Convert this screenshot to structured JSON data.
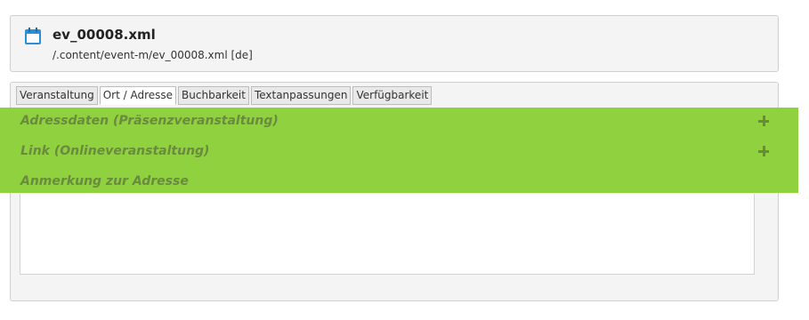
{
  "header": {
    "icon": "calendar-icon",
    "title": "ev_00008.xml",
    "path": "/.content/event-m/ev_00008.xml [de]"
  },
  "tabs": [
    {
      "label": "Veranstaltung",
      "active": false
    },
    {
      "label": "Ort / Adresse",
      "active": true
    },
    {
      "label": "Buchbarkeit",
      "active": false
    },
    {
      "label": "Textanpassungen",
      "active": false
    },
    {
      "label": "Verfügbarkeit",
      "active": false
    }
  ],
  "sections": [
    {
      "label": "Adressdaten (Präsenzveranstaltung)",
      "icon": "plus-icon"
    },
    {
      "label": "Link (Onlineveranstaltung)",
      "icon": "plus-icon"
    },
    {
      "label": "Anmerkung zur Adresse"
    }
  ],
  "note_field": {
    "value": ""
  },
  "colors": {
    "highlight": "#8fd13f",
    "section_label": "#6a8a3f",
    "icon_blue": "#2a8fd6"
  }
}
